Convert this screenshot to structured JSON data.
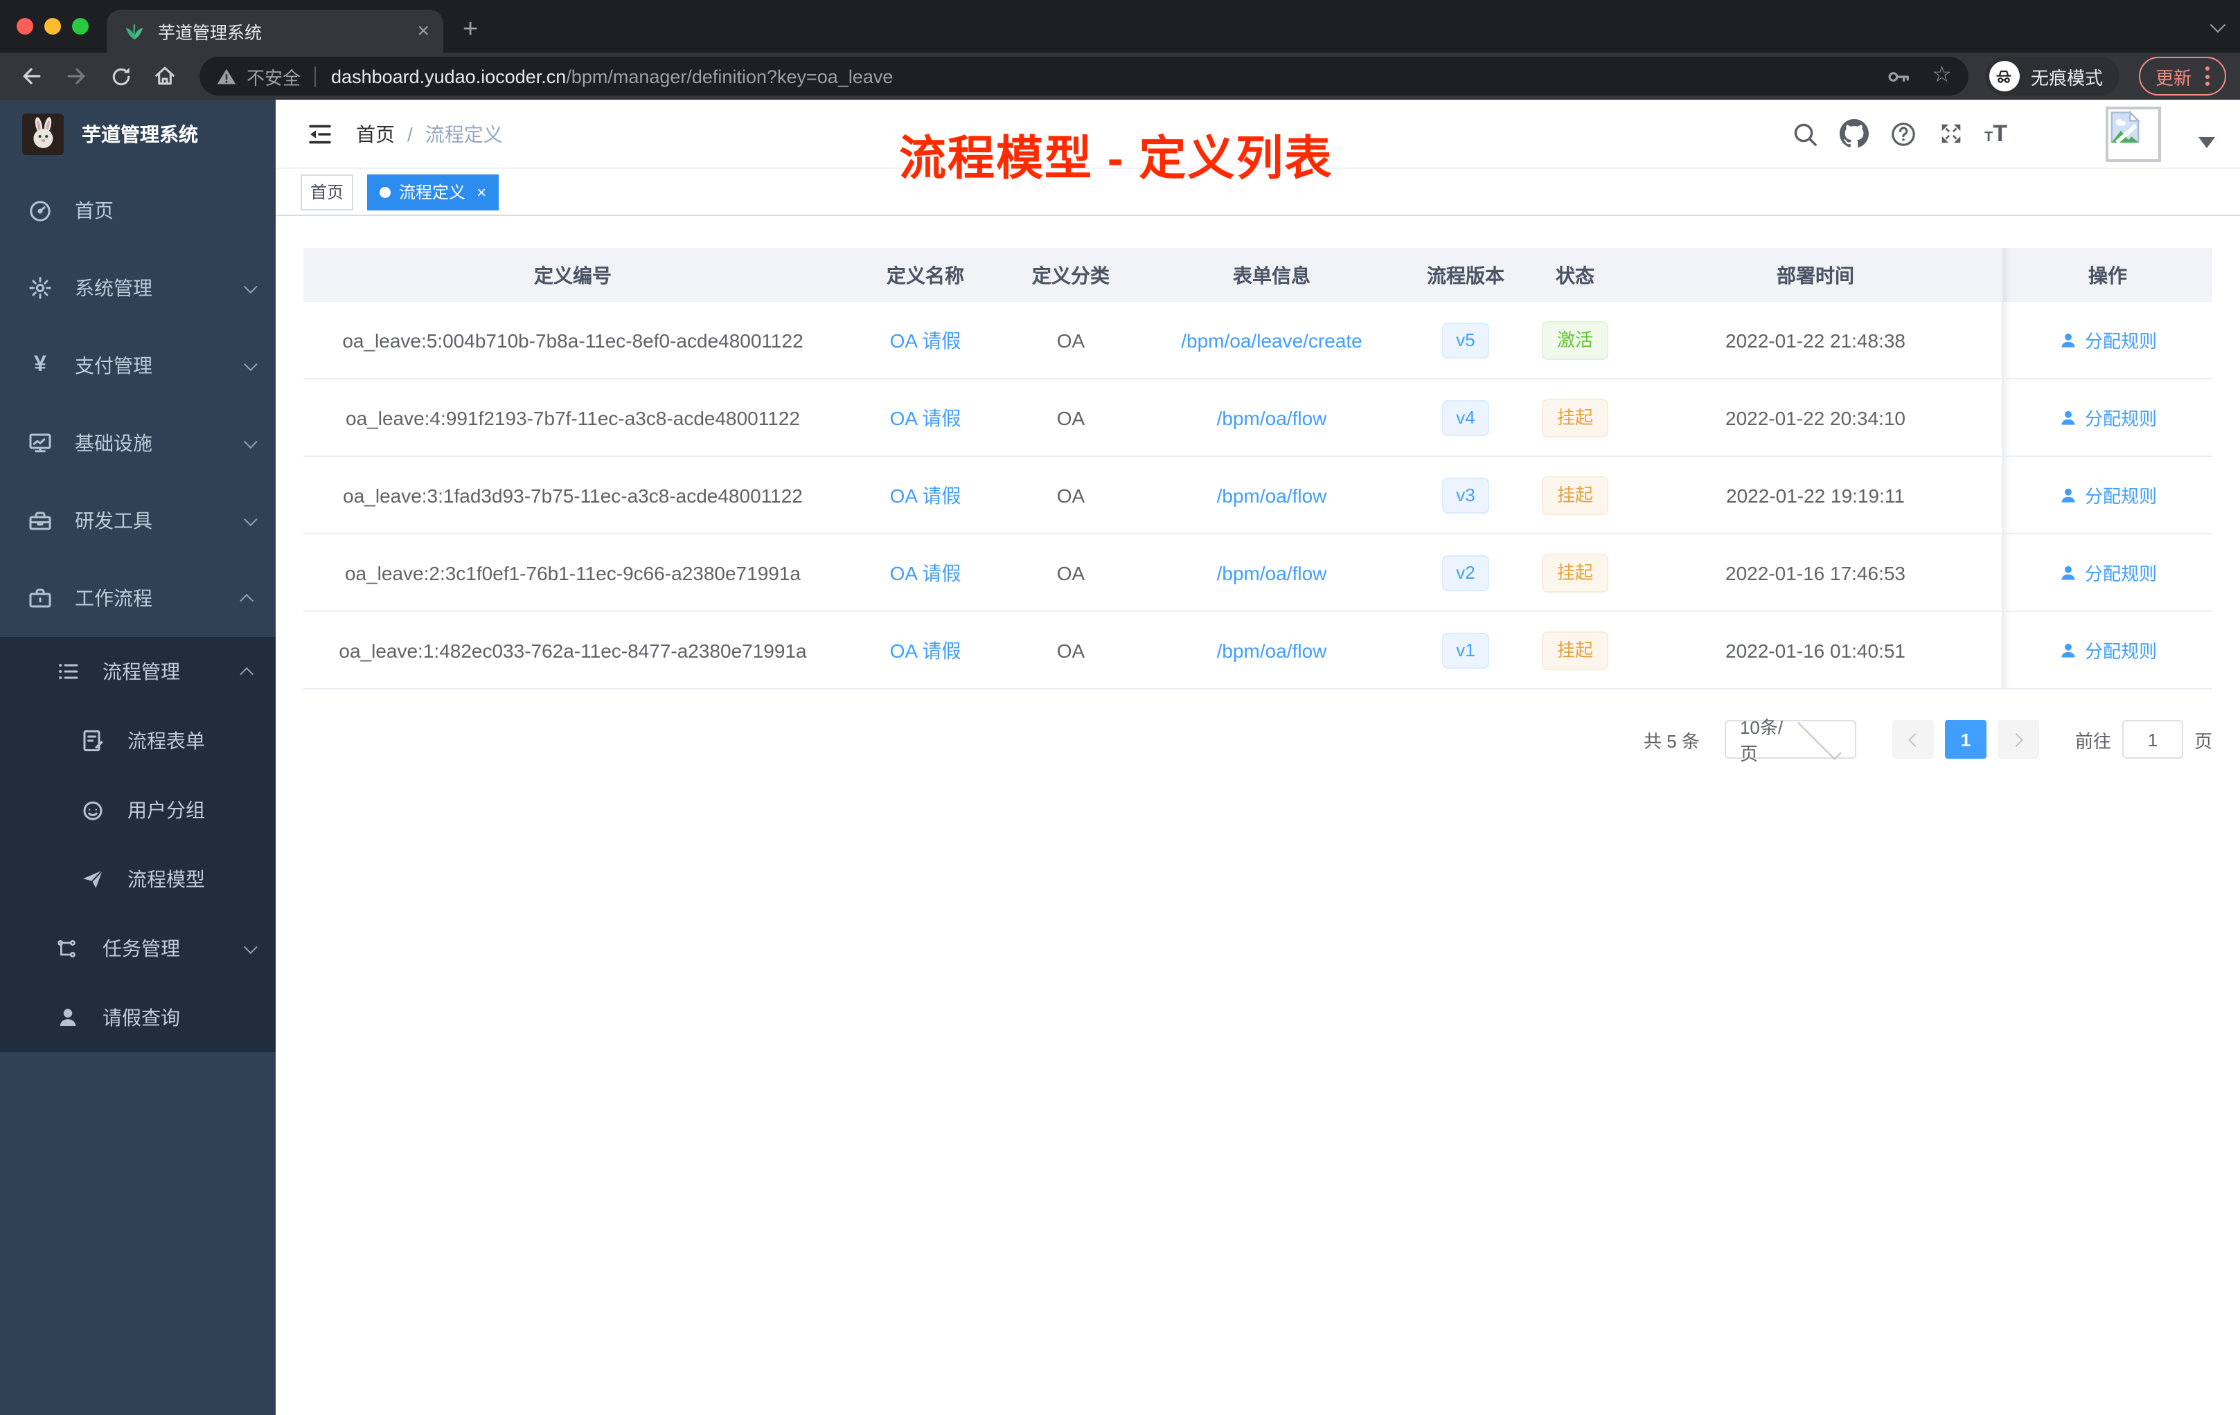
{
  "browser": {
    "tab_title": "芋道管理系统",
    "close_tab": "×",
    "new_tab": "+",
    "security_label": "不安全",
    "url_host": "dashboard.yudao.iocoder.cn",
    "url_path": "/bpm/manager/definition?key=oa_leave",
    "incognito_label": "无痕模式",
    "update_label": "更新"
  },
  "sidebar": {
    "app_title": "芋道管理系统",
    "items": [
      {
        "label": "首页",
        "icon": "dashboard-icon"
      },
      {
        "label": "系统管理",
        "icon": "gear-icon"
      },
      {
        "label": "支付管理",
        "icon": "yen-icon"
      },
      {
        "label": "基础设施",
        "icon": "monitor-icon"
      },
      {
        "label": "研发工具",
        "icon": "toolbox-icon"
      },
      {
        "label": "工作流程",
        "icon": "briefcase-icon"
      },
      {
        "label": "流程管理",
        "icon": "list-icon"
      },
      {
        "label": "流程表单",
        "icon": "form-icon"
      },
      {
        "label": "用户分组",
        "icon": "robot-icon"
      },
      {
        "label": "流程模型",
        "icon": "send-icon"
      },
      {
        "label": "任务管理",
        "icon": "tree-icon"
      },
      {
        "label": "请假查询",
        "icon": "user-icon"
      }
    ]
  },
  "header": {
    "breadcrumb_home": "首页",
    "breadcrumb_sep": "/",
    "breadcrumb_current": "流程定义",
    "annotation": "流程模型 - 定义列表"
  },
  "tags": {
    "home": "首页",
    "active": "流程定义",
    "active_close": "×"
  },
  "table": {
    "columns": [
      "定义编号",
      "定义名称",
      "定义分类",
      "表单信息",
      "流程版本",
      "状态",
      "部署时间",
      "操作"
    ],
    "rows": [
      {
        "id": "oa_leave:5:004b710b-7b8a-11ec-8ef0-acde48001122",
        "name": "OA 请假",
        "category": "OA",
        "form": "/bpm/oa/leave/create",
        "version": "v5",
        "status": "激活",
        "status_type": "success",
        "time": "2022-01-22 21:48:38",
        "action": "分配规则"
      },
      {
        "id": "oa_leave:4:991f2193-7b7f-11ec-a3c8-acde48001122",
        "name": "OA 请假",
        "category": "OA",
        "form": "/bpm/oa/flow",
        "version": "v4",
        "status": "挂起",
        "status_type": "warning",
        "time": "2022-01-22 20:34:10",
        "action": "分配规则"
      },
      {
        "id": "oa_leave:3:1fad3d93-7b75-11ec-a3c8-acde48001122",
        "name": "OA 请假",
        "category": "OA",
        "form": "/bpm/oa/flow",
        "version": "v3",
        "status": "挂起",
        "status_type": "warning",
        "time": "2022-01-22 19:19:11",
        "action": "分配规则"
      },
      {
        "id": "oa_leave:2:3c1f0ef1-76b1-11ec-9c66-a2380e71991a",
        "name": "OA 请假",
        "category": "OA",
        "form": "/bpm/oa/flow",
        "version": "v2",
        "status": "挂起",
        "status_type": "warning",
        "time": "2022-01-16 17:46:53",
        "action": "分配规则"
      },
      {
        "id": "oa_leave:1:482ec033-762a-11ec-8477-a2380e71991a",
        "name": "OA 请假",
        "category": "OA",
        "form": "/bpm/oa/flow",
        "version": "v1",
        "status": "挂起",
        "status_type": "warning",
        "time": "2022-01-16 01:40:51",
        "action": "分配规则"
      }
    ]
  },
  "pagination": {
    "total": "共 5 条",
    "page_size": "10条/页",
    "current_page": "1",
    "goto_label": "前往",
    "goto_value": "1",
    "unit": "页"
  },
  "colors": {
    "accent_blue": "#409eff",
    "success_green": "#67c23a",
    "warning_orange": "#e6a23c",
    "annotation_red": "#ff2a00",
    "sidebar_bg": "#304156",
    "submenu_bg": "#1f2d3d",
    "active_tag_blue": "#2d8cf0",
    "update_salmon": "#f28b82"
  }
}
